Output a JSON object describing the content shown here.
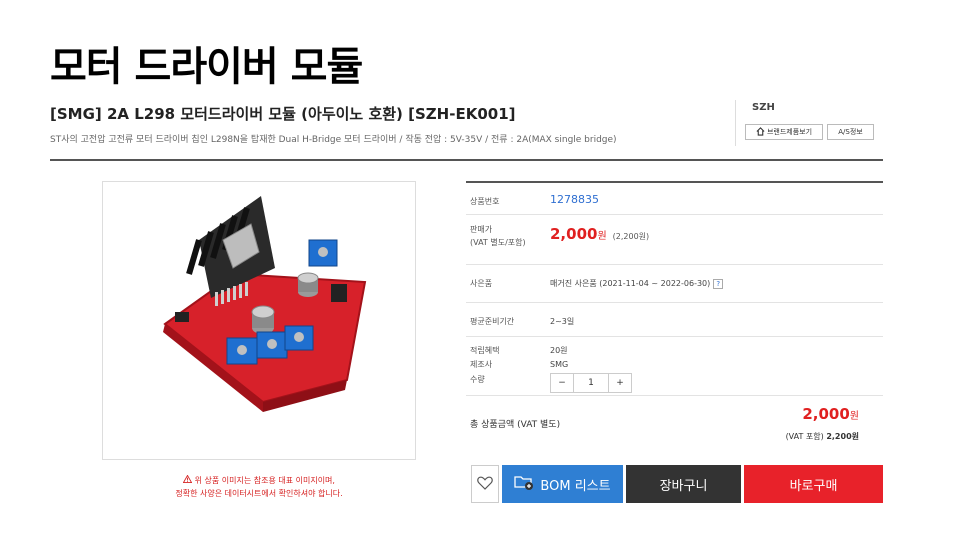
{
  "slide": {
    "title": "모터 드라이버 모듈"
  },
  "product": {
    "title": "[SMG] 2A L298 모터드라이버 모듈 (아두이노 호환) [SZH-EK001]",
    "description": "ST사의 고전압 고전류 모터 드라이버 칩인 L298N을 탑재한 Dual H-Bridge 모터 드라이버 / 작동 전압 : 5V-35V / 전류 : 2A(MAX single bridge)"
  },
  "brand": {
    "name": "SZH",
    "brand_products_label": "브랜드제품보기",
    "as_info_label": "A/S정보"
  },
  "image": {
    "alt": "L298 모터드라이버 모듈",
    "note_line1": "위 상품 이미지는 참조용 대표 이미지이며,",
    "note_line2": "정확한 사양은 데이터시트에서 확인하셔야 합니다."
  },
  "info": {
    "code_label": "상품번호",
    "code_value": "1278835",
    "price_label_1": "판매가",
    "price_label_2": "(VAT 별도/포함)",
    "price_value": "2,000",
    "price_unit": "원",
    "price_vat": "(2,200원)",
    "gift_label": "사은품",
    "gift_value": "매거진 사은품 (2021-11-04 ~ 2022-06-30)",
    "gift_help": "?",
    "shipping_label": "평균준비기간",
    "shipping_value": "2~3일",
    "points_label": "적립혜택",
    "points_value": "20원",
    "maker_label": "제조사",
    "maker_value": "SMG",
    "qty_label": "수량",
    "qty_minus": "−",
    "qty_value": "1",
    "qty_plus": "+"
  },
  "total": {
    "label": "총 상품금액 (VAT 별도)",
    "price": "2,000",
    "unit": "원",
    "sub_label": "(VAT 포함)",
    "sub_price": "2,200원"
  },
  "buttons": {
    "bom": "BOM 리스트",
    "cart": "장바구니",
    "buy": "바로구매"
  },
  "colors": {
    "accent_blue": "#2f7fd3",
    "price_red": "#e02020",
    "buy_red": "#e8222a",
    "cart_dark": "#333333"
  }
}
